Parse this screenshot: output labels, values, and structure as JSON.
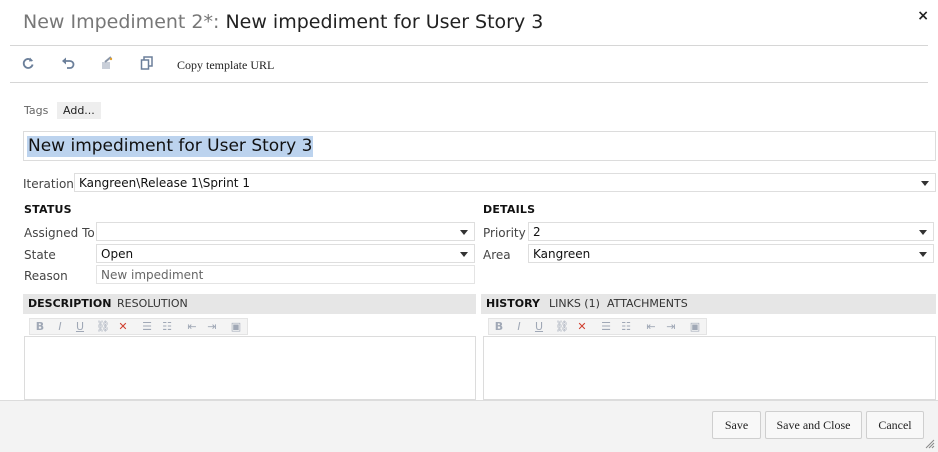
{
  "window": {
    "title_prefix": "New Impediment 2*:",
    "title_main": "New impediment for User Story 3",
    "close_glyph": "×"
  },
  "toolbar": {
    "icons": [
      "refresh-icon",
      "undo-icon",
      "clean-icon",
      "copy-icon"
    ],
    "copy_template_url": "Copy template URL"
  },
  "tags": {
    "label": "Tags",
    "add_label": "Add..."
  },
  "work_item": {
    "title_value": "New impediment for User Story 3"
  },
  "iteration": {
    "label": "Iteration",
    "value": "Kangreen\\Release 1\\Sprint 1"
  },
  "status": {
    "heading": "STATUS",
    "assigned_to_label": "Assigned To",
    "assigned_to_value": "",
    "state_label": "State",
    "state_value": "Open",
    "reason_label": "Reason",
    "reason_value": "New impediment"
  },
  "details": {
    "heading": "DETAILS",
    "priority_label": "Priority",
    "priority_value": "2",
    "area_label": "Area",
    "area_value": "Kangreen"
  },
  "left_tabs": [
    "DESCRIPTION",
    "RESOLUTION"
  ],
  "right_tabs": [
    "HISTORY",
    "LINKS (1)",
    "ATTACHMENTS"
  ],
  "rte_toolbar": {
    "glyphs": [
      "B",
      "I",
      "U",
      "⛓",
      "✕",
      "☰",
      "☷",
      "⇤",
      "⇥",
      "▣"
    ]
  },
  "footer": {
    "save": "Save",
    "save_and_close": "Save and Close",
    "cancel": "Cancel"
  },
  "colors": {
    "selection": "#bcd3ee",
    "tab_bar": "#e6e6e6",
    "footer_bg": "#f3f3f3",
    "clear_red": "#d04030"
  }
}
